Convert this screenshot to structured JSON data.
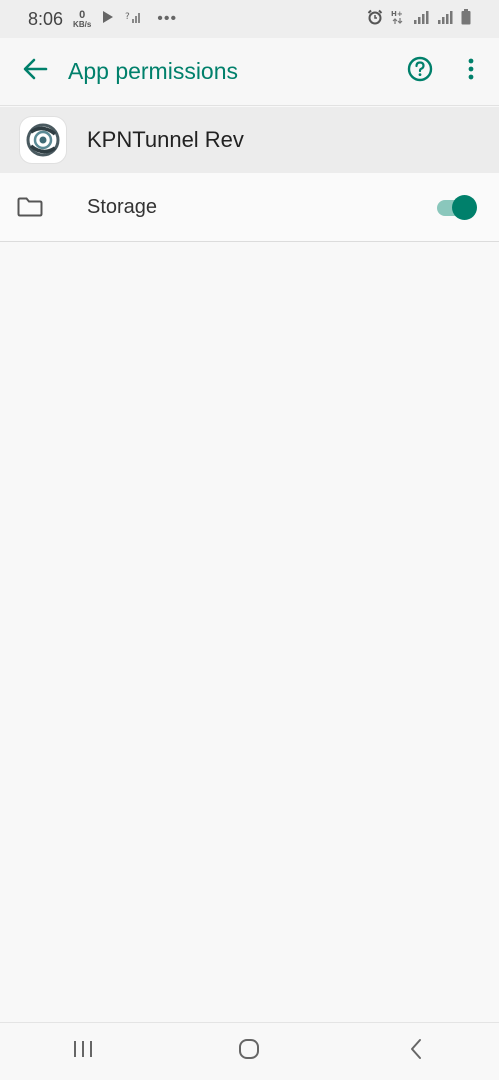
{
  "status_bar": {
    "time": "8:06",
    "net_speed_value": "0",
    "net_speed_unit": "KB/s",
    "overflow": "•••"
  },
  "app_bar": {
    "title": "App permissions"
  },
  "app": {
    "name": "KPNTunnel Rev"
  },
  "permissions": [
    {
      "label": "Storage",
      "icon": "folder-icon",
      "enabled": true
    }
  ],
  "colors": {
    "accent": "#00806b",
    "toggle_track": "#8ac7bc"
  }
}
